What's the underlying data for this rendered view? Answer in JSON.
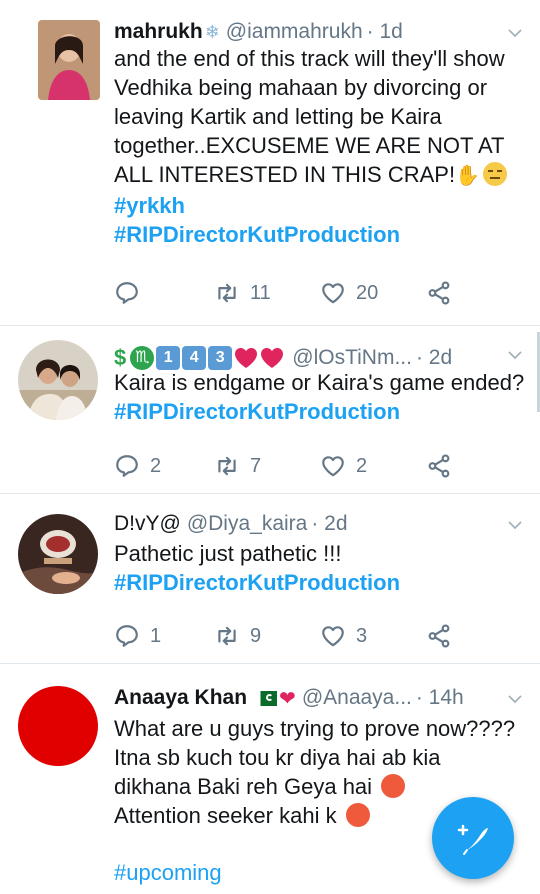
{
  "tweets": [
    {
      "name": "mahrukh",
      "handle": "@iammahrukh",
      "time": "· 1d",
      "text": "and the end of this track will they'll show Vedhika being mahaan by divorcing or leaving Kartik and letting be Kaira together..EXCUSEME WE ARE NOT AT ALL INTERESTED IN THIS CRAP!",
      "tags": [
        "#yrkkh",
        "#RIPDirectorKutProduction"
      ],
      "replies": "",
      "retweets": "11",
      "likes": "20"
    },
    {
      "name": "$ ♏ 1 4 3",
      "handle": "@lOsTiNm...",
      "time": "· 2d",
      "text": "Kaira is endgame or Kaira's game ended?",
      "tags": [
        "#RIPDirectorKutProduction"
      ],
      "replies": "2",
      "retweets": "7",
      "likes": "2"
    },
    {
      "name": "D!vY@",
      "handle": "@Diya_kaira",
      "time": "· 2d",
      "text": "Pathetic  just pathetic !!!",
      "tags": [
        "#RIPDirectorKutProduction"
      ],
      "replies": "1",
      "retweets": "9",
      "likes": "3"
    },
    {
      "name": "Anaaya Khan",
      "handle": "@Anaaya...",
      "time": "· 14h",
      "text_lines": [
        "What are u guys trying to prove now????",
        "Itna sb kuch tou kr diya hai ab kia",
        "dikhana Baki reh Geya hai",
        "Attention seeker kahi k"
      ],
      "tags": [
        "#upcoming"
      ]
    }
  ],
  "icons": {
    "reply": "reply-icon",
    "retweet": "retweet-icon",
    "like": "heart-icon",
    "share": "share-icon",
    "more": "chevron-down-icon",
    "compose": "compose-tweet-icon"
  },
  "colors": {
    "accent": "#1da1f2",
    "secondary_text": "#657786",
    "divider": "#e1e8ed"
  }
}
